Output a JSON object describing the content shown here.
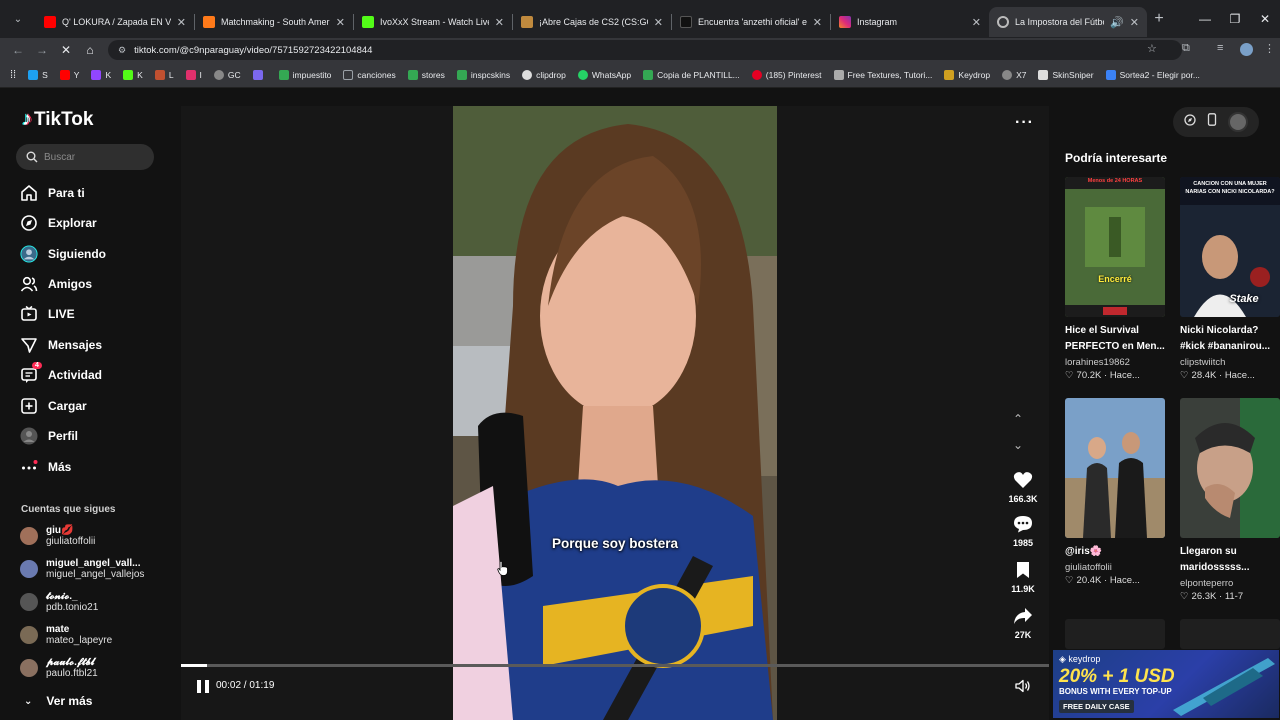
{
  "browser": {
    "tabs": [
      {
        "title": "Q' LOKURA / Zapada EN VIVO",
        "fav": "#ff0000"
      },
      {
        "title": "Matchmaking - South America",
        "fav": "#ff7a1a"
      },
      {
        "title": "IvoXxX Stream - Watch Live on",
        "fav": "#53fc18"
      },
      {
        "title": "¡Abre Cajas de CS2 (CS:GO), Ga",
        "fav": "#c08a3e"
      },
      {
        "title": "Encuentra 'anzethi oficial' en Ti",
        "fav": "#111111"
      },
      {
        "title": "Instagram",
        "fav": "#e1306c"
      },
      {
        "title": "La Impostora del Fútbol: ¡H",
        "fav": "#bbbbbb"
      }
    ],
    "url": "tiktok.com/@c9nparaguay/video/7571592723422104844",
    "bookmarks": [
      {
        "label": "S",
        "color": "#1da1f2"
      },
      {
        "label": "Y",
        "color": "#ff0000"
      },
      {
        "label": "K",
        "color": "#9146ff"
      },
      {
        "label": "K",
        "color": "#53fc18"
      },
      {
        "label": "L",
        "color": "#c05030"
      },
      {
        "label": "I",
        "color": "#e1306c"
      },
      {
        "label": "GC",
        "color": "#888888"
      },
      {
        "label": "",
        "color": "#7b68ee"
      },
      {
        "label": "impuestito",
        "color": "#34a853"
      },
      {
        "label": "canciones",
        "color": "#9aa0a6"
      },
      {
        "label": "stores",
        "color": "#34a853"
      },
      {
        "label": "inspcskins",
        "color": "#34a853"
      },
      {
        "label": "clipdrop",
        "color": "#dddddd"
      },
      {
        "label": "WhatsApp",
        "color": "#25d366"
      },
      {
        "label": "Copia de PLANTILL...",
        "color": "#34a853"
      },
      {
        "label": "(185) Pinterest",
        "color": "#e60023"
      },
      {
        "label": "Free Textures, Tutori...",
        "color": "#aaaaaa"
      },
      {
        "label": "Keydrop",
        "color": "#d0a020"
      },
      {
        "label": "X7",
        "color": "#888888"
      },
      {
        "label": "SkinSniper",
        "color": "#dddddd"
      },
      {
        "label": "Sortea2 - Elegir por...",
        "color": "#3b82f6"
      }
    ]
  },
  "tiktok": {
    "logo": "TikTok",
    "search_placeholder": "Buscar",
    "nav": [
      {
        "label": "Para ti",
        "icon": "home-icon"
      },
      {
        "label": "Explorar",
        "icon": "compass-icon"
      },
      {
        "label": "Siguiendo",
        "icon": "following-icon"
      },
      {
        "label": "Amigos",
        "icon": "friends-icon"
      },
      {
        "label": "LIVE",
        "icon": "live-icon"
      },
      {
        "label": "Mensajes",
        "icon": "messages-icon"
      },
      {
        "label": "Actividad",
        "icon": "activity-icon",
        "badge": "4"
      },
      {
        "label": "Cargar",
        "icon": "upload-icon"
      },
      {
        "label": "Perfil",
        "icon": "profile-avatar"
      },
      {
        "label": "Más",
        "icon": "more-icon"
      }
    ],
    "following_title": "Cuentas que sigues",
    "following": [
      {
        "name": "giu💋",
        "user": "giuliatoffolii",
        "color": "#a0705a"
      },
      {
        "name": "miguel_angel_vall...",
        "user": "miguel_angel_vallejos",
        "color": "#6a7ab0"
      },
      {
        "name": "𝓽𝓸𝓷𝓲𝓸._",
        "user": "pdb.tonio21",
        "color": "#555555"
      },
      {
        "name": "mate",
        "user": "mateo_lapeyre",
        "color": "#7a6a55"
      },
      {
        "name": "𝓹𝓪𝓾𝓵𝓸.𝓯𝓽𝓫𝓵",
        "user": "paulo.ftbl21",
        "color": "#8a7060"
      }
    ],
    "see_more": "Ver más"
  },
  "video": {
    "caption": "Porque soy bostera",
    "likes": "166.3K",
    "comments": "1985",
    "saves": "11.9K",
    "shares": "27K",
    "time_current": "00:02",
    "time_total": "01:19",
    "progress": 0.03
  },
  "recommendations": {
    "title": "Podría interesarte",
    "items": [
      {
        "title": "Hice el Survival PERFECTO en Men...",
        "user": "lorahines19862",
        "likes": "70.2K",
        "age": "Hace...",
        "overlay": "Encerré",
        "top": "Menos de 24 HORAS",
        "theme": "minecraft"
      },
      {
        "title": "Nicki Nicolarda? #kick #bananirou...",
        "user": "clipstwiitch",
        "likes": "28.4K",
        "age": "Hace...",
        "overlay": "Stake",
        "top": "CANCION CON UNA MUJER NARIAS CON NICKI NICOLARDA?",
        "theme": "stream"
      },
      {
        "title": "@iris🌸",
        "user": "giuliatoffolii",
        "likes": "20.4K",
        "age": "Hace...",
        "overlay": "",
        "top": "",
        "theme": "couple"
      },
      {
        "title": "Llegaron su maridosssss...",
        "user": "elponteperro",
        "likes": "26.3K",
        "age": "11-7",
        "overlay": "",
        "top": "",
        "theme": "crowd"
      }
    ]
  },
  "ad": {
    "brand": "keydrop",
    "headline": "20% + 1 USD",
    "sub": "BONUS WITH EVERY TOP-UP",
    "cta": "FREE DAILY CASE"
  }
}
